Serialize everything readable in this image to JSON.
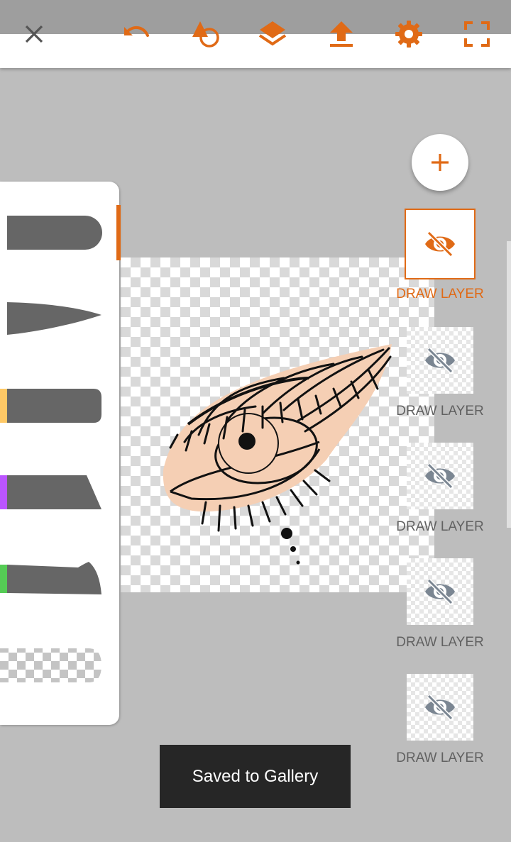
{
  "toolbar": {
    "accent": "#e06a16",
    "buttons": [
      {
        "name": "close",
        "icon": "close-icon"
      },
      {
        "name": "undo",
        "icon": "undo-icon"
      },
      {
        "name": "shapes",
        "icon": "shapes-icon"
      },
      {
        "name": "layers",
        "icon": "layers-icon"
      },
      {
        "name": "export",
        "icon": "upload-icon"
      },
      {
        "name": "settings",
        "icon": "gear-icon"
      },
      {
        "name": "fullscreen",
        "icon": "fullscreen-icon"
      }
    ]
  },
  "brushes": [
    {
      "name": "round-brush",
      "color": "#666666",
      "selected": true
    },
    {
      "name": "taper-brush",
      "color": "#666666"
    },
    {
      "name": "marker-brush",
      "color": "#666666",
      "swatch": "#ffc966"
    },
    {
      "name": "calligraphy-brush",
      "color": "#666666",
      "swatch": "#bb55ff"
    },
    {
      "name": "knife-brush",
      "color": "#666666",
      "swatch": "#55cc55"
    },
    {
      "name": "eraser-brush",
      "pattern": "checker"
    }
  ],
  "layers": {
    "add_icon": "plus-icon",
    "items": [
      {
        "label": "DRAW LAYER",
        "selected": true,
        "icon": "eye-hidden-icon"
      },
      {
        "label": "DRAW LAYER",
        "icon": "eye-hidden-icon"
      },
      {
        "label": "DRAW LAYER",
        "icon": "eye-hidden-icon"
      },
      {
        "label": "DRAW LAYER",
        "icon": "eye-hidden-icon"
      },
      {
        "label": "DRAW LAYER",
        "icon": "eye-hidden-icon"
      }
    ]
  },
  "toast": {
    "text": "Saved to Gallery"
  }
}
